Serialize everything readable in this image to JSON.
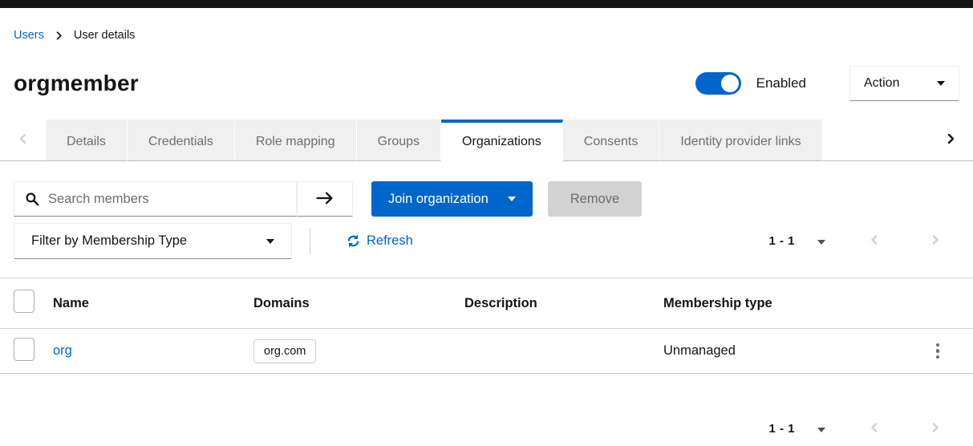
{
  "breadcrumb": {
    "items": [
      {
        "label": "Users"
      },
      {
        "label": "User details"
      }
    ]
  },
  "page_header": {
    "title": "orgmember",
    "enabled_toggle": {
      "state": "on",
      "label": "Enabled"
    },
    "action_menu_label": "Action"
  },
  "tabs": {
    "items": [
      {
        "label": "Details",
        "active": false
      },
      {
        "label": "Credentials",
        "active": false
      },
      {
        "label": "Role mapping",
        "active": false
      },
      {
        "label": "Groups",
        "active": false
      },
      {
        "label": "Organizations",
        "active": true
      },
      {
        "label": "Consents",
        "active": false
      },
      {
        "label": "Identity provider links",
        "active": false
      }
    ]
  },
  "toolbar": {
    "search": {
      "placeholder": "Search members",
      "value": ""
    },
    "join_organization_button": "Join organization",
    "remove_button": "Remove",
    "remove_button_disabled": true,
    "filter_dropdown_label": "Filter by Membership Type",
    "refresh_label": "Refresh",
    "pagination_top": {
      "range": "1 - 1"
    }
  },
  "table": {
    "columns": [
      "Name",
      "Domains",
      "Description",
      "Membership type"
    ],
    "rows": [
      {
        "name": "org",
        "domains": [
          "org.com"
        ],
        "description": "",
        "membership_type": "Unmanaged"
      }
    ]
  },
  "pagination_bottom": {
    "range": "1 - 1"
  },
  "icons": {
    "breadcrumb-separator-icon": "›",
    "search-icon": "magnifying-glass",
    "submit-search-icon": "→",
    "caret-down-icon": "▾",
    "refresh-icon": "circular-sync-arrows",
    "prev-page-icon": "‹",
    "next-page-icon": "›",
    "scroll-left-icon": "‹",
    "scroll-right-icon": "›",
    "kebab-icon": "⋮"
  },
  "colors": {
    "masthead_black": "#151515",
    "primary_blue": "#0066cc",
    "link_blue": "#0066cc",
    "active_tab_accent": "#0066cc",
    "tab_background": "#f0f0f0",
    "muted_text": "#6a6e73",
    "border_gray": "#d2d2d2",
    "disabled_button_bg": "#d2d2d2"
  }
}
